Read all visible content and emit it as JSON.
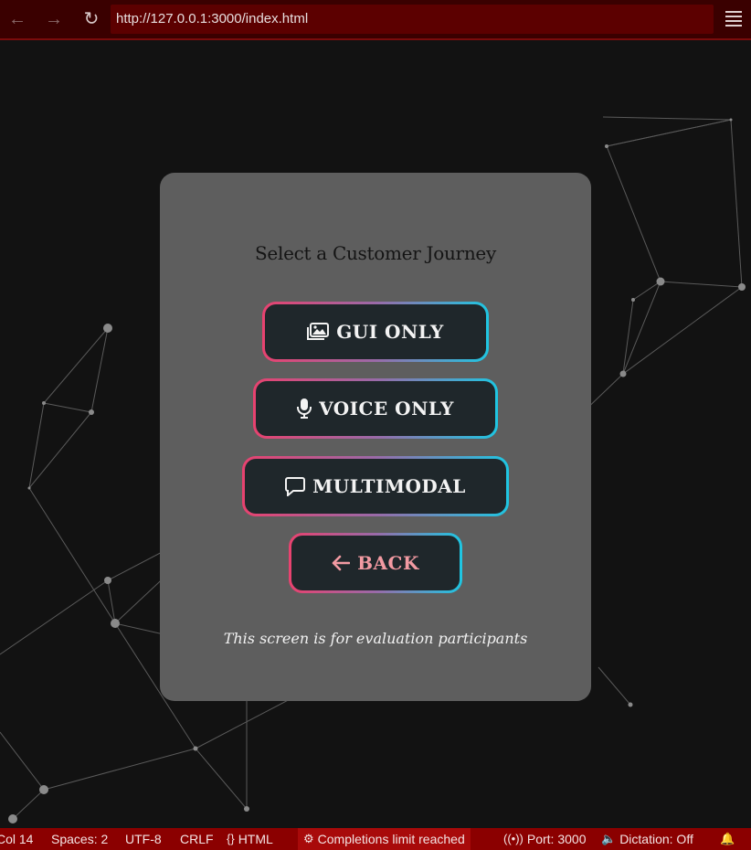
{
  "browser": {
    "url": "http://127.0.0.1:3000/index.html",
    "back_icon": "arrow-left-icon",
    "forward_icon": "arrow-right-icon",
    "reload_icon": "reload-icon",
    "menu_icon": "hamburger-menu-icon"
  },
  "card": {
    "title": "Select a Customer Journey",
    "buttons": [
      {
        "label": "GUI ONLY",
        "icon": "images-icon"
      },
      {
        "label": "VOICE ONLY",
        "icon": "microphone-icon"
      },
      {
        "label": "MULTIMODAL",
        "icon": "comment-icon"
      },
      {
        "label": "BACK",
        "icon": "arrow-left-icon"
      }
    ],
    "note": "This screen is for evaluation participants"
  },
  "statusbar": {
    "col": "Col 14",
    "spaces": "Spaces: 2",
    "encoding": "UTF-8",
    "eol": "CRLF",
    "language": "HTML",
    "completions": "Completions limit reached",
    "port": "Port: 3000",
    "dictation": "Dictation: Off"
  },
  "colors": {
    "topbar": "#3a0000",
    "url_bar": "#5c0000",
    "card": "#5e5e5e",
    "button_bg": "#1f272b",
    "gradient_start": "#e8426f",
    "gradient_end": "#1ec6e2",
    "back_label": "#f29aa2",
    "statusbar": "#8b0000"
  }
}
